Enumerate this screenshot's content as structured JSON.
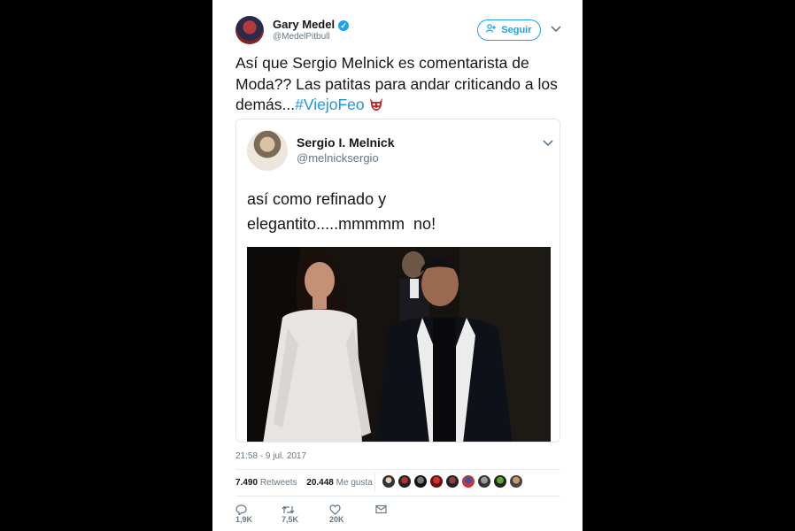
{
  "tweet": {
    "author_name": "Gary Medel",
    "author_handle": "@MedelPitbull",
    "follow_label": "Seguir",
    "text_main": "Así que Sergio Melnick es comentarista de Moda?? Las patitas para andar criticando a los demás...",
    "hashtag": "#ViejoFeo",
    "timestamp": "21:58 - 9 jul. 2017",
    "retweets_count": "7.490",
    "retweets_label": "Retweets",
    "likes_count": "20.448",
    "likes_label": "Me gusta",
    "replies": "1,9K",
    "retweets_short": "7,5K",
    "likes_short": "20K"
  },
  "quoted": {
    "author_name": "Sergio I. Melnick",
    "author_handle": "@melnicksergio",
    "line1": "así como refinado y",
    "line2": "elegantito.....mmmmm  no!"
  },
  "colors": {
    "accent": "#1da1f2",
    "hashtag": "#1b95e0",
    "muted": "#657786",
    "background": "#000000"
  },
  "icons": [
    "verified-icon",
    "add-user-icon",
    "chevron-down-icon",
    "devil-emoji-icon",
    "reply-icon",
    "retweet-icon",
    "like-icon",
    "message-icon"
  ]
}
